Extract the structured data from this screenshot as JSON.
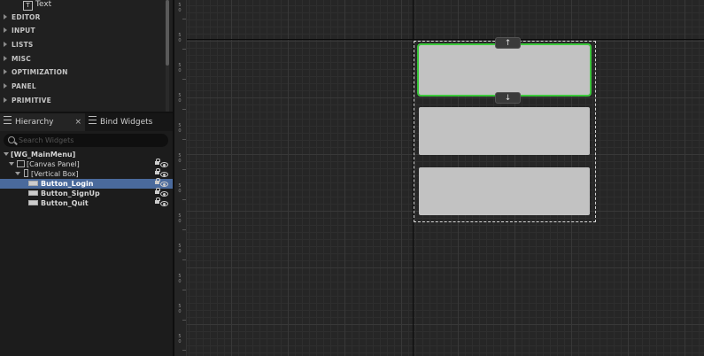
{
  "palette": {
    "top_item": "Text",
    "categories": [
      "EDITOR",
      "INPUT",
      "LISTS",
      "MISC",
      "OPTIMIZATION",
      "PANEL",
      "PRIMITIVE"
    ]
  },
  "tabs": {
    "hierarchy": "Hierarchy",
    "close": "×",
    "bind_widgets": "Bind Widgets"
  },
  "search": {
    "placeholder": "Search Widgets"
  },
  "tree": [
    {
      "label": "[WG_MainMenu]"
    },
    {
      "label": "[Canvas Panel]"
    },
    {
      "label": "[Vertical Box]"
    },
    {
      "label": "Button_Login",
      "selected": true
    },
    {
      "label": "Button_SignUp"
    },
    {
      "label": "Button_Quit"
    }
  ],
  "canvas": {
    "move_up": "↑",
    "move_down": "↓",
    "selection_color": "#3cc83c",
    "grid_color": "#262626"
  }
}
